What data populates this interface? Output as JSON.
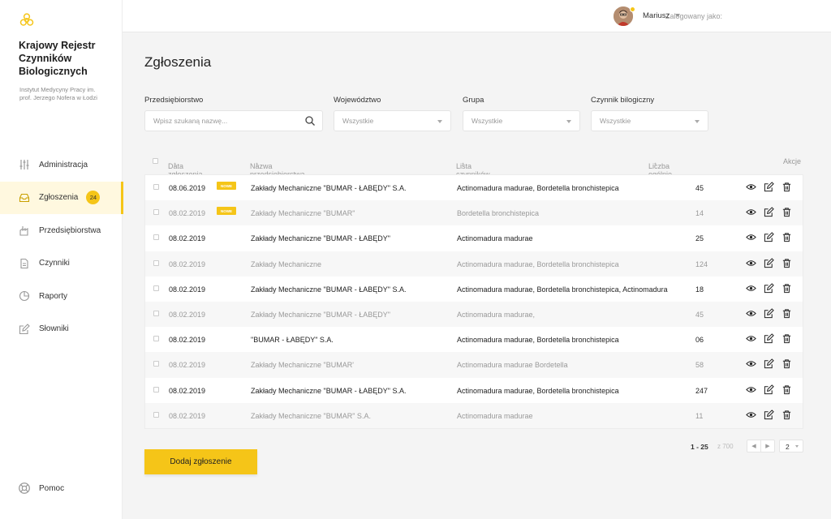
{
  "app": {
    "title": "Krajowy Rejestr Czynników Biologicznych",
    "subtitle": "Instytut Medycyny Pracy im. prof. Jerzego Nofera w Łodzi",
    "accent": "#f5c518"
  },
  "sidebar": {
    "items": [
      {
        "label": "Administracja",
        "icon": "sliders-icon"
      },
      {
        "label": "Zgłoszenia",
        "icon": "inbox-icon",
        "badge": "24",
        "active": true
      },
      {
        "label": "Przedsiębiorstwa",
        "icon": "factory-icon"
      },
      {
        "label": "Czynniki",
        "icon": "document-icon"
      },
      {
        "label": "Raporty",
        "icon": "pie-chart-icon"
      },
      {
        "label": "Słowniki",
        "icon": "edit-icon"
      }
    ],
    "help": "Pomoc"
  },
  "topbar": {
    "login_label": "Zalogowany jako:",
    "user_name": "Mariusz"
  },
  "page": {
    "title": "Zgłoszenia"
  },
  "filters": {
    "company": {
      "label": "Przedsiębiorstwo",
      "placeholder": "Wpisz szukaną nazwę..."
    },
    "voivodeship": {
      "label": "Województwo",
      "value": "Wszystkie"
    },
    "group": {
      "label": "Grupa",
      "value": "Wszystkie"
    },
    "agent": {
      "label": "Czynnik bilogiczny",
      "value": "Wszystkie"
    }
  },
  "table": {
    "headers": {
      "date": "Data zgłoszenia",
      "company": "Nazwa przedsiębiorstwa",
      "agents": "Lista czynników objętych zgłoszeniem",
      "exposed": "Liczba ogólnie narażonych",
      "actions": "Akcje"
    },
    "new_badge": "NOWE",
    "rows": [
      {
        "date": "08.06.2019",
        "is_new": true,
        "company": "Zakłady Mechaniczne \"BUMAR - ŁABĘDY\" S.A.",
        "agents": "Actinomadura madurae, Bordetella bronchistepica",
        "exposed": "45"
      },
      {
        "date": "08.02.2019",
        "is_new": true,
        "company": "Zakłady Mechaniczne \"BUMAR\"",
        "agents": "Bordetella bronchistepica",
        "exposed": "14"
      },
      {
        "date": "08.02.2019",
        "is_new": false,
        "company": "Zakłady Mechaniczne \"BUMAR - ŁABĘDY\"",
        "agents": "Actinomadura madurae",
        "exposed": "25"
      },
      {
        "date": "08.02.2019",
        "is_new": false,
        "company": "Zakłady Mechaniczne",
        "agents": "Actinomadura madurae, Bordetella bronchistepica",
        "exposed": "124"
      },
      {
        "date": "08.02.2019",
        "is_new": false,
        "company": "Zakłady Mechaniczne \"BUMAR - ŁABĘDY\" S.A.",
        "agents": "Actinomadura madurae, Bordetella bronchistepica, Actinomadura",
        "exposed": "18"
      },
      {
        "date": "08.02.2019",
        "is_new": false,
        "company": "Zakłady Mechaniczne \"BUMAR - ŁABĘDY\"",
        "agents": "Actinomadura madurae,",
        "exposed": "45"
      },
      {
        "date": "08.02.2019",
        "is_new": false,
        "company": "\"BUMAR - ŁABĘDY\" S.A.",
        "agents": "Actinomadura madurae, Bordetella bronchistepica",
        "exposed": "06"
      },
      {
        "date": "08.02.2019",
        "is_new": false,
        "company": "Zakłady Mechaniczne \"BUMAR'",
        "agents": "Actinomadura madurae Bordetella",
        "exposed": "58"
      },
      {
        "date": "08.02.2019",
        "is_new": false,
        "company": "Zakłady Mechaniczne \"BUMAR - ŁABĘDY\" S.A.",
        "agents": "Actinomadura madurae, Bordetella bronchistepica",
        "exposed": "247"
      },
      {
        "date": "08.02.2019",
        "is_new": false,
        "company": "Zakłady Mechaniczne \"BUMAR\" S.A.",
        "agents": "Actinomadura madurae",
        "exposed": "11"
      }
    ]
  },
  "pagination": {
    "range": "1 - 25",
    "total": "z 700",
    "page": "2"
  },
  "add_button": "Dodaj zgłoszenie"
}
